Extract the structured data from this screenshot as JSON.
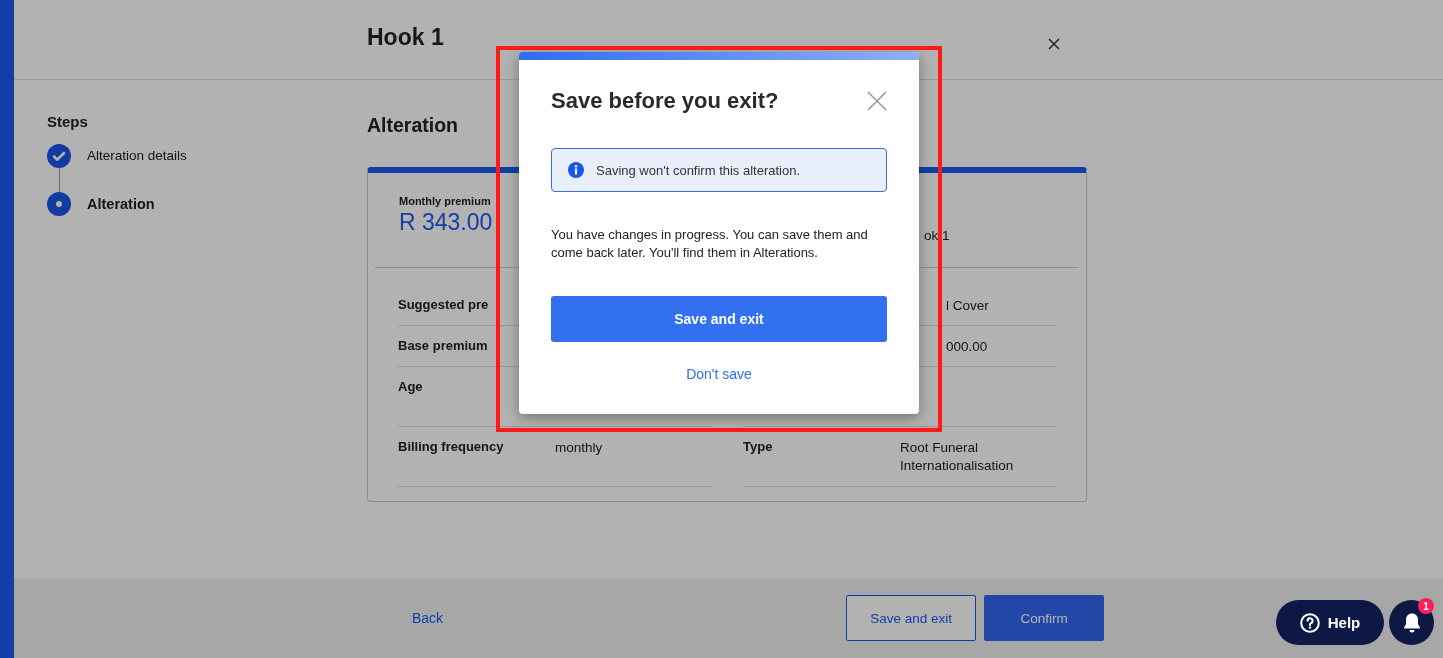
{
  "header": {
    "title": "Hook 1"
  },
  "steps": {
    "heading": "Steps",
    "items": [
      {
        "label": "Alteration details",
        "completed": true,
        "selected": false
      },
      {
        "label": "Alteration",
        "completed": false,
        "selected": true
      }
    ]
  },
  "content": {
    "heading": "Alteration",
    "summary": [
      {
        "label": "Monthly premium",
        "value": "R 343.00"
      },
      {
        "value": "ok 1"
      }
    ],
    "rows": [
      {
        "left": {
          "label": "Suggested pre"
        },
        "right": {
          "value": "l Cover"
        }
      },
      {
        "left": {
          "label": "Base premium"
        },
        "right": {
          "value": "000.00"
        }
      },
      {
        "left": {
          "label": "Age"
        }
      },
      {
        "left": {
          "label": "Billing frequency",
          "value": "monthly"
        },
        "right": {
          "label": "Type",
          "value": "Root Funeral Internationalisation"
        }
      }
    ]
  },
  "footer": {
    "back": "Back",
    "buttons": [
      {
        "label": "Save and exit",
        "kind": "outline"
      },
      {
        "label": "Confirm",
        "kind": "primary"
      }
    ]
  },
  "modal": {
    "title": "Save before you exit?",
    "notice": "Saving won't confirm this alteration.",
    "message": "You have changes in progress. You can save them and come back later. You'll find them in Alterations.",
    "primary": "Save and exit",
    "secondary": "Don't save"
  },
  "help": {
    "label": "Help"
  },
  "notifications": {
    "count": "1"
  }
}
